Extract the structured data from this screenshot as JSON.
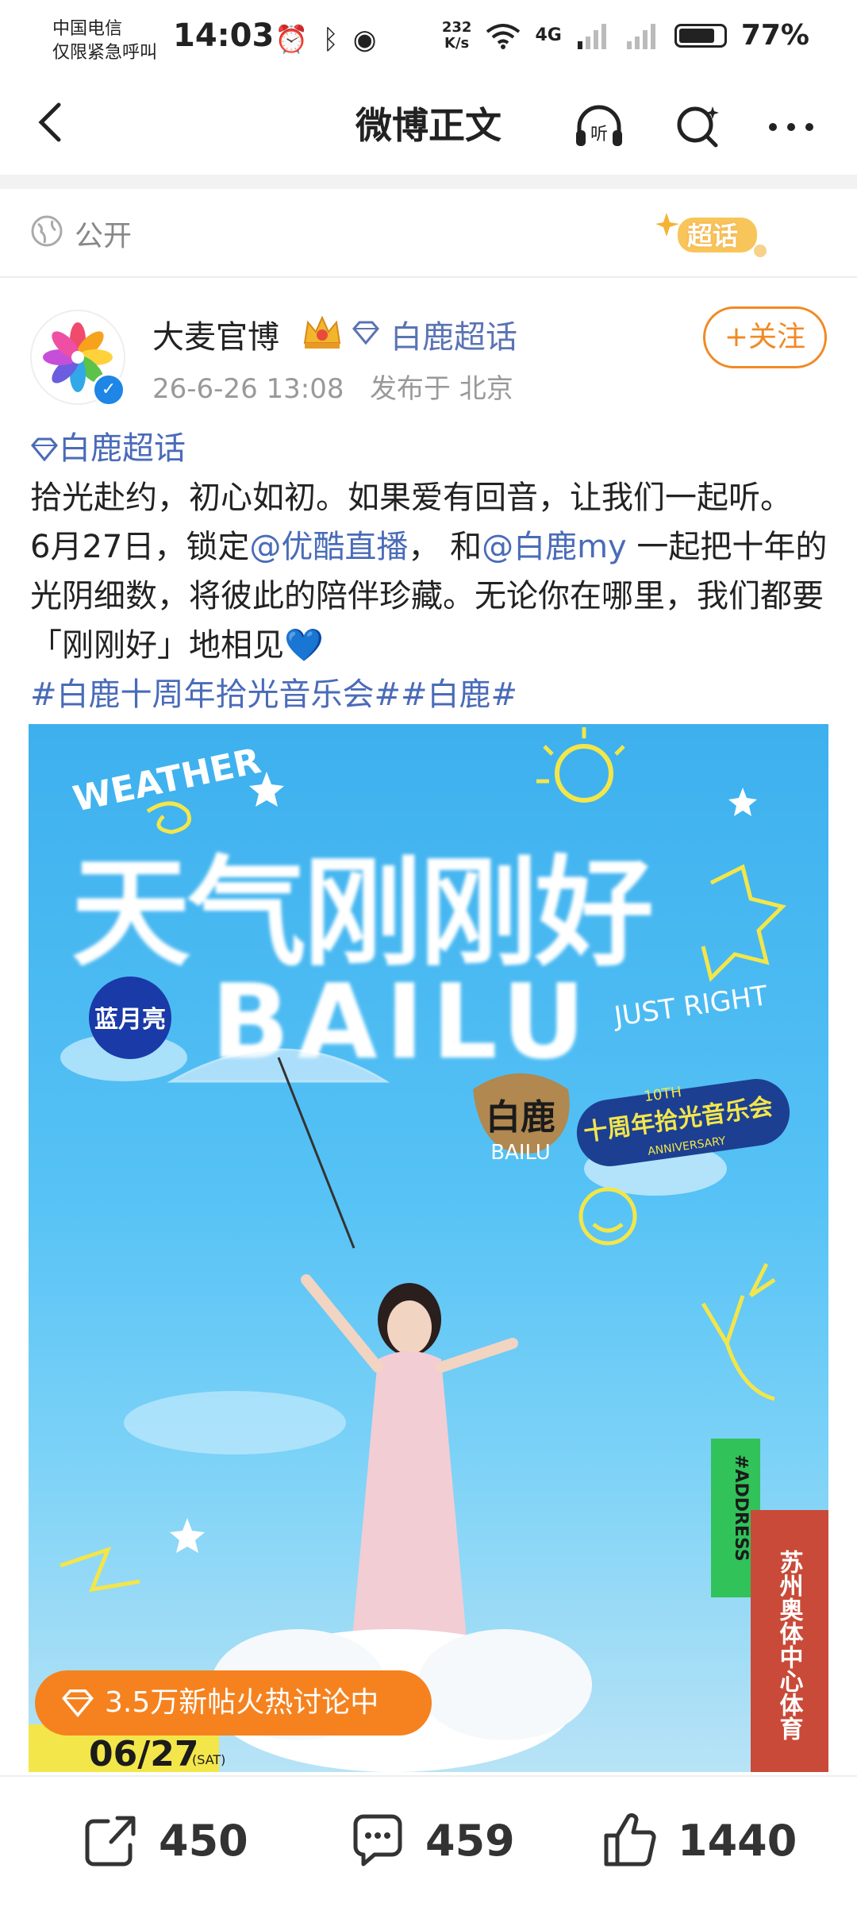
{
  "status_bar": {
    "carrier_line1": "中国电信",
    "carrier_line2": "仅限紧急呼叫",
    "time": "14:03",
    "net_speed_value": "232",
    "net_speed_unit": "K/s",
    "network": "4G",
    "battery": "77%"
  },
  "nav": {
    "title": "微博正文",
    "listen_label": "听"
  },
  "visibility": {
    "label": "公开"
  },
  "badge": {
    "label": "超话"
  },
  "post": {
    "author": "大麦官博",
    "topic": "白鹿超话",
    "time": "26-6-26 13:08",
    "location": "发布于 北京",
    "follow_label": "+关注",
    "topic_link": "白鹿超话",
    "line1": "拾光赴约，初心如初。如果爱有回音，让我们一起听。",
    "line2a": "6月27日，锁定",
    "mention1": "@优酷直播",
    "line2b": "， 和",
    "mention2": "@白鹿my",
    "line2c": " 一起把十年的光阴细数，将彼此的陪伴珍藏。无论你在哪里，我们都要「刚刚好」地相见",
    "heart": "💙",
    "hashtags": "#白鹿十周年拾光音乐会##白鹿#"
  },
  "poster": {
    "weather_text": "WEATHER",
    "title_cn": "天气刚刚好",
    "title_en": "BAILU",
    "just_right": "JUST RIGHT",
    "sponsor": "蓝月亮",
    "tag_name": "白鹿",
    "tag_name_en": "BAILU",
    "anniv_top": "10TH",
    "anniv_main": "十周年拾光音乐会",
    "anniv_bottom": "ANNIVERSARY",
    "address_tag": "#ADDRESS",
    "venue": "苏州奥体中心体育",
    "date": "06/27",
    "day": "(SAT)"
  },
  "hot": {
    "label": "3.5万新帖火热讨论中"
  },
  "actions": {
    "share_count": "450",
    "comment_count": "459",
    "like_count": "1440"
  },
  "colors": {
    "accent_orange": "#f08a24",
    "link_blue": "#4a6bb8",
    "poster_sky": "#3db0ee"
  }
}
